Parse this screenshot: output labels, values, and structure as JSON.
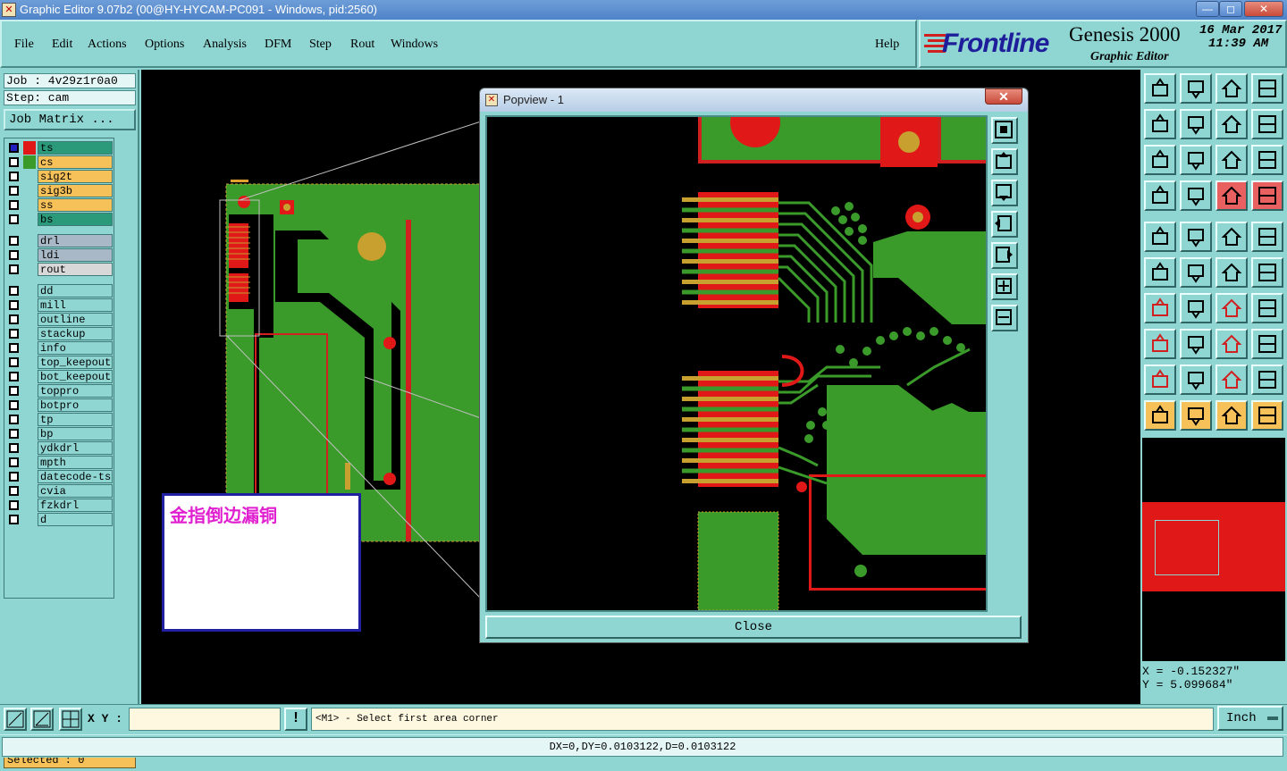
{
  "window": {
    "title": "Graphic Editor 9.07b2 (00@HY-HYCAM-PC091 - Windows, pid:2560)",
    "min": "—",
    "max": "◻",
    "close": "✕"
  },
  "menu": {
    "file": "File",
    "edit": "Edit",
    "actions": "Actions",
    "options": "Options",
    "analysis": "Analysis",
    "dfm": "DFM",
    "step": "Step",
    "rout": "Rout",
    "windows": "Windows",
    "help": "Help"
  },
  "brand": {
    "logo": "Frontline",
    "product": "Genesis 2000",
    "subtitle": "Graphic Editor",
    "date": "16 Mar 2017",
    "time": "11:39 AM"
  },
  "job": {
    "job": "Job : 4v29z1r0a0",
    "step": "Step: cam",
    "matrix_button": "Job Matrix ..."
  },
  "layers": [
    {
      "name": "ts",
      "color": "#e01818",
      "bg": "#2a9a7a"
    },
    {
      "name": "cs",
      "color": "#3a9a2a",
      "bg": "#f7c15a"
    },
    {
      "name": "sig2t",
      "color": "",
      "bg": "#f7c15a"
    },
    {
      "name": "sig3b",
      "color": "",
      "bg": "#f7c15a"
    },
    {
      "name": "ss",
      "color": "",
      "bg": "#f7c15a"
    },
    {
      "name": "bs",
      "color": "",
      "bg": "#2a9a7a"
    },
    {
      "name": "drl",
      "color": "",
      "bg": "#a9b8c6"
    },
    {
      "name": "ldi",
      "color": "",
      "bg": "#a9b8c6"
    },
    {
      "name": "rout",
      "color": "",
      "bg": "#d8d8d8"
    },
    {
      "name": "dd",
      "color": "",
      "bg": "#8fd6d3"
    },
    {
      "name": "mill",
      "color": "",
      "bg": "#8fd6d3"
    },
    {
      "name": "outline",
      "color": "",
      "bg": "#8fd6d3"
    },
    {
      "name": "stackup",
      "color": "",
      "bg": "#8fd6d3"
    },
    {
      "name": "info",
      "color": "",
      "bg": "#8fd6d3"
    },
    {
      "name": "top_keepout",
      "color": "",
      "bg": "#8fd6d3"
    },
    {
      "name": "bot_keepout",
      "color": "",
      "bg": "#8fd6d3"
    },
    {
      "name": "toppro",
      "color": "",
      "bg": "#8fd6d3"
    },
    {
      "name": "botpro",
      "color": "",
      "bg": "#8fd6d3"
    },
    {
      "name": "tp",
      "color": "",
      "bg": "#8fd6d3"
    },
    {
      "name": "bp",
      "color": "",
      "bg": "#8fd6d3"
    },
    {
      "name": "ydkdrl",
      "color": "",
      "bg": "#8fd6d3"
    },
    {
      "name": "mpth",
      "color": "",
      "bg": "#8fd6d3"
    },
    {
      "name": "datecode-ts",
      "color": "",
      "bg": "#8fd6d3"
    },
    {
      "name": "cvia",
      "color": "",
      "bg": "#8fd6d3"
    },
    {
      "name": "fzkdrl",
      "color": "",
      "bg": "#8fd6d3"
    },
    {
      "name": "d",
      "color": "",
      "bg": "#8fd6d3"
    }
  ],
  "selected": "Selected : 0",
  "popview": {
    "title": "Popview - 1",
    "close_label": "Close"
  },
  "note": {
    "text": "金指倒边漏铜"
  },
  "coords": {
    "x": "X = -0.152327\"",
    "y": "Y = 5.099684\""
  },
  "cmd": {
    "xy_label": "X Y :",
    "xy_value": "",
    "warn": "!",
    "prompt": "<M1> - Select first area corner",
    "unit": "Inch"
  },
  "status": "DX=0,DY=0.0103122,D=0.0103122",
  "colors": {
    "copper_red": "#e01818",
    "copper_green": "#3a9a2a",
    "gold": "#c8a030",
    "panel": "#8fd6d3"
  }
}
